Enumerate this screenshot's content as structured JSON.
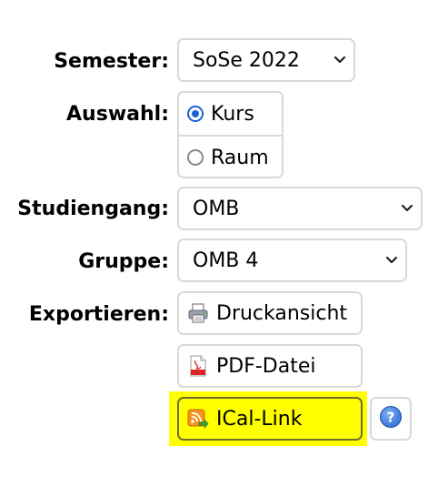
{
  "form": {
    "semester": {
      "label": "Semester:",
      "value": "SoSe 2022",
      "icon": "chevron-down-icon"
    },
    "auswahl": {
      "label": "Auswahl:",
      "options": [
        {
          "label": "Kurs",
          "selected": true
        },
        {
          "label": "Raum",
          "selected": false
        }
      ]
    },
    "studiengang": {
      "label": "Studiengang:",
      "value": "OMB",
      "icon": "chevron-down-icon"
    },
    "gruppe": {
      "label": "Gruppe:",
      "value": "OMB 4",
      "icon": "chevron-down-icon"
    },
    "exportieren": {
      "label": "Exportieren:",
      "buttons": [
        {
          "label": "Druckansicht",
          "icon": "printer-icon"
        },
        {
          "label": "PDF-Datei",
          "icon": "pdf-file-icon"
        },
        {
          "label": "ICal-Link",
          "icon": "rss-feed-icon",
          "highlighted": true
        }
      ],
      "help_icon": "help-icon"
    }
  },
  "colors": {
    "highlight": "#ffff00",
    "radio_accent": "#1a63d6",
    "help_blue": "#2f6fd6",
    "border": "#d9d9d9"
  }
}
